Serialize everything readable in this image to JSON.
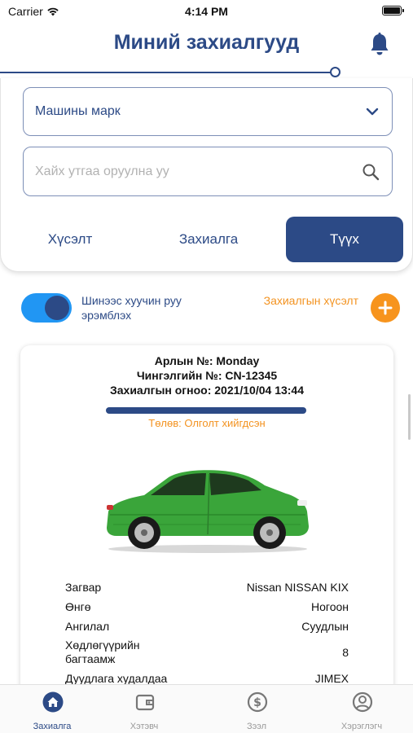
{
  "status_bar": {
    "carrier": "Carrier",
    "time": "4:14 PM"
  },
  "header": {
    "title": "Миний захиалгууд",
    "bell_icon": "bell-icon"
  },
  "filters": {
    "brand_select_value": "Машины марк",
    "search_placeholder": "Хайх утгаа оруулна уу",
    "tabs": [
      {
        "label": "Хүсэлт",
        "active": false
      },
      {
        "label": "Захиалга",
        "active": false
      },
      {
        "label": "Түүх",
        "active": true
      }
    ]
  },
  "sort": {
    "toggle_on": true,
    "label": "Шинээс хуучин руу эрэмблэх",
    "request_label": "Захиалгын хүсэлт",
    "add_icon": "plus-icon"
  },
  "order": {
    "plate_line": "Арлын №: Monday",
    "chassis_line": "Чингэлгийн №: CN-12345",
    "date_line": "Захиалгын огноо: 2021/10/04 13:44",
    "payment_status": "Төлөв: Олголт хийгдсэн",
    "specs": [
      {
        "label": "Загвар",
        "value": "Nissan NISSAN KIX"
      },
      {
        "label": "Өнгө",
        "value": "Ногоон"
      },
      {
        "label": "Ангилал",
        "value": "Суудлын"
      },
      {
        "label": "Хөдлөгүүрийн багтаамж",
        "value": "8"
      },
      {
        "label": "Дуудлага худалдаа",
        "value": "JIMEX"
      }
    ]
  },
  "nav": [
    {
      "label": "Захиалга",
      "icon": "home-icon",
      "active": true
    },
    {
      "label": "Хэтэвч",
      "icon": "wallet-icon",
      "active": false
    },
    {
      "label": "Зээл",
      "icon": "dollar-icon",
      "active": false
    },
    {
      "label": "Хэрэглэгч",
      "icon": "user-icon",
      "active": false
    }
  ],
  "colors": {
    "primary": "#2c4a86",
    "accent": "#f7941d",
    "toggle": "#2196f3",
    "car": "#3aa53a"
  }
}
